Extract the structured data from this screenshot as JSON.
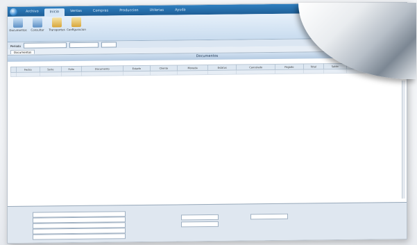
{
  "window": {
    "title": "",
    "tabs": [
      "Archivo",
      "Inicio",
      "Ventas",
      "Compras",
      "Produccion",
      "Utilerias",
      "Ayuda"
    ],
    "active_tab": "Inicio"
  },
  "ribbon": {
    "buttons": [
      "Documentos",
      "Consultar",
      "Transportes",
      "Configuracion"
    ]
  },
  "filter": {
    "label": "Periodo",
    "value": "",
    "date_from": "",
    "date_to": ""
  },
  "doc_tab": {
    "label": "Documentos"
  },
  "grid": {
    "title": "Documentos",
    "hint": "",
    "columns": [
      "",
      "Fecha",
      "Serie",
      "Folio",
      "Documento",
      "Estado",
      "Cliente",
      "Moneda",
      "Estatus",
      "Cancelado",
      "Pagado",
      "Total",
      "Saldo",
      "Cobrado",
      "Neto"
    ],
    "rows": [],
    "totals": [
      "",
      "",
      "",
      "",
      "",
      "",
      "",
      "",
      "",
      "",
      "",
      "",
      "",
      "",
      ""
    ]
  },
  "details": {
    "header": "",
    "left_labels": [
      "",
      "",
      "",
      "",
      ""
    ],
    "left_values": [
      "",
      "",
      "",
      "",
      ""
    ],
    "mid_labels": [
      "",
      ""
    ],
    "mid_values": [
      "",
      ""
    ],
    "right_label": "",
    "right_value": ""
  }
}
